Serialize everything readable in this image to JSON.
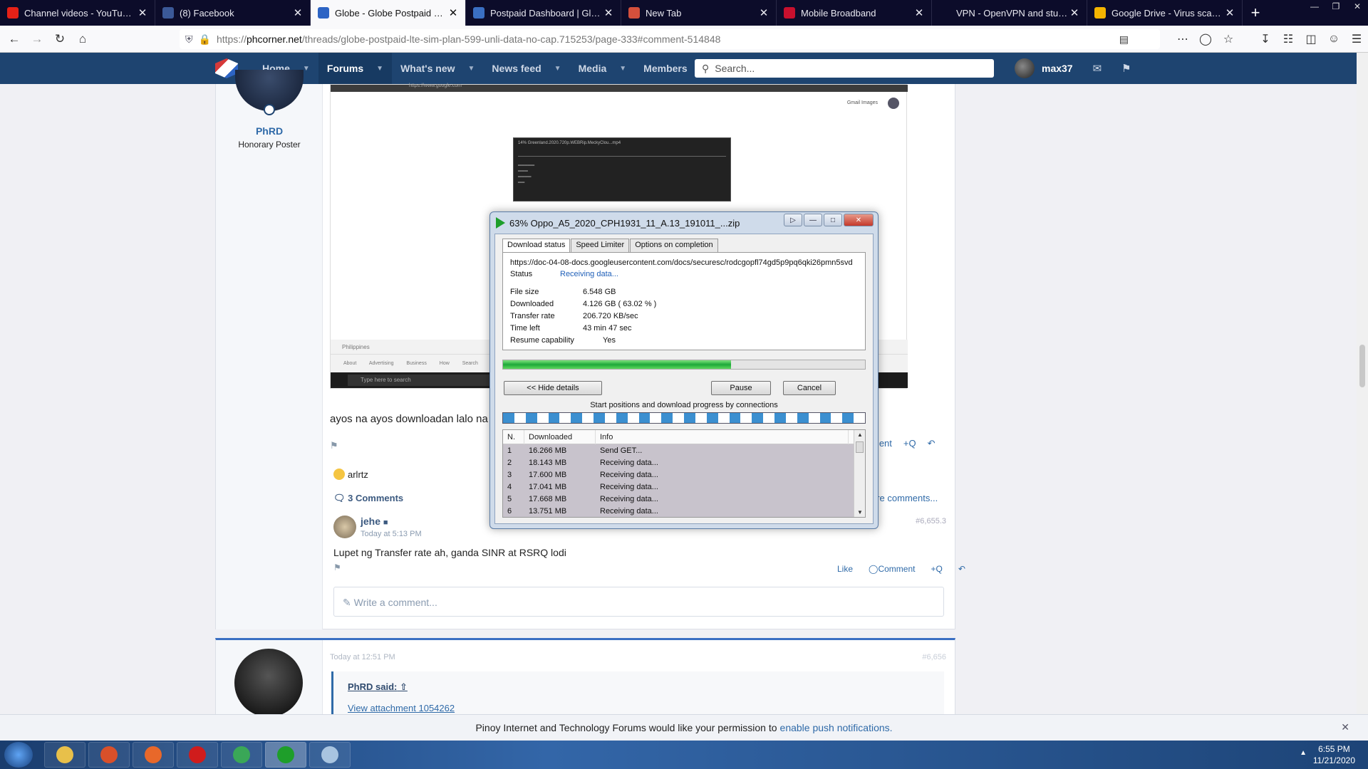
{
  "browser": {
    "tabs": [
      {
        "title": "Channel videos - YouTube Studio",
        "favicon_color": "#e62117",
        "icon": "youtube-icon"
      },
      {
        "title": "(8) Facebook",
        "favicon_color": "#3b5998",
        "icon": "facebook-icon"
      },
      {
        "title": "Globe - Globe Postpaid LTE sim plan",
        "favicon_color": "#2d64c4",
        "icon": "phcorner-icon",
        "active": true
      },
      {
        "title": "Postpaid Dashboard | GlobeOne",
        "favicon_color": "#3a6fc2",
        "icon": "globe-icon"
      },
      {
        "title": "New Tab",
        "favicon_color": "#d4503c",
        "icon": "firefox-icon"
      },
      {
        "title": "Mobile Broadband",
        "favicon_color": "#c8102e",
        "icon": "huawei-icon"
      },
      {
        "title": "VPN - OpenVPN and stunnel",
        "favicon_color": "#0c0c2a",
        "icon": "blank-icon"
      },
      {
        "title": "Google Drive - Virus scan warning",
        "favicon_color": "#f4b400",
        "icon": "google-drive-icon"
      }
    ],
    "url": {
      "prefix": "https://",
      "domain": "phcorner.net",
      "path": "/threads/globe-postpaid-lte-sim-plan-599-unli-data-no-cap.715253/page-333#comment-514848"
    }
  },
  "forum_header": {
    "nav": [
      {
        "label": "Home",
        "active": false
      },
      {
        "label": "Forums",
        "active": true
      },
      {
        "label": "What's new",
        "active": false
      },
      {
        "label": "News feed",
        "active": false
      },
      {
        "label": "Media",
        "active": false
      },
      {
        "label": "Members",
        "active": false
      }
    ],
    "search_placeholder": "Search...",
    "username": "max37"
  },
  "post": {
    "author": "PhRD",
    "author_title": "Honorary Poster",
    "text": "ayos na ayos downloadan lalo na",
    "actions": [
      "ment",
      "+Q"
    ],
    "reaction_user": "arlrtz",
    "comments_label": "3 Comments",
    "more_comments": "ore comments...",
    "screenshot": {
      "address": "https://www.google.com",
      "links": "Gmail   Images",
      "footer_country": "Philippines",
      "footer_links": "About Advertising Business How Search works",
      "taskbar_search": "Type here to search",
      "mini_window_title": "14% Greenland.2020.720p.WEBRip.MeckyClou...mp4"
    }
  },
  "comment": {
    "author": "jehe",
    "time": "Today at 5:13 PM",
    "number": "#6,655.3",
    "text": "Lupet ng Transfer rate ah, ganda SINR at RSRQ lodi",
    "actions": [
      "Like",
      "Comment",
      "+Q"
    ]
  },
  "write_comment_placeholder": "Write a comment...",
  "post2": {
    "time": "Today at 12:51 PM",
    "number": "#6,656",
    "quote_by": "PhRD said:",
    "attachment": "View attachment 1054262"
  },
  "push_notice": {
    "text": "Pinoy Internet and Technology Forums would like your permission to",
    "link": "enable push notifications."
  },
  "idm": {
    "title": "63% Oppo_A5_2020_CPH1931_11_A.13_191011_...zip",
    "tabs": [
      "Download status",
      "Speed Limiter",
      "Options on completion"
    ],
    "url": "https://doc-04-08-docs.googleusercontent.com/docs/securesc/rodcgopfl74gd5p9pq6qki26pmn5svd",
    "status_label": "Status",
    "status_value": "Receiving data...",
    "fields": [
      {
        "k": "File size",
        "v": "6.548  GB"
      },
      {
        "k": "Downloaded",
        "v": "4.126  GB  ( 63.02 % )"
      },
      {
        "k": "Transfer rate",
        "v": "206.720  KB/sec"
      },
      {
        "k": "Time left",
        "v": "43 min 47 sec"
      },
      {
        "k": "Resume capability",
        "v": "Yes"
      }
    ],
    "progress_percent": 63.02,
    "buttons": {
      "hide": "<< Hide details",
      "pause": "Pause",
      "cancel": "Cancel"
    },
    "conn_label": "Start positions and download progress by connections",
    "columns": [
      "N.",
      "Downloaded",
      "Info"
    ],
    "connections": [
      {
        "n": "1",
        "d": "16.266  MB",
        "i": "Send GET..."
      },
      {
        "n": "2",
        "d": "18.143  MB",
        "i": "Receiving data..."
      },
      {
        "n": "3",
        "d": "17.600  MB",
        "i": "Receiving data..."
      },
      {
        "n": "4",
        "d": "17.041  MB",
        "i": "Receiving data..."
      },
      {
        "n": "5",
        "d": "17.668  MB",
        "i": "Receiving data..."
      },
      {
        "n": "6",
        "d": "13.751  MB",
        "i": "Receiving data..."
      }
    ],
    "conn_segment_colors": {
      "done": "#3b8fd0",
      "gap": "#ffffff"
    }
  },
  "taskbar": {
    "time": "6:55 PM",
    "date": "11/21/2020",
    "apps": [
      {
        "name": "explorer",
        "color": "#e8c04a"
      },
      {
        "name": "media-player",
        "color": "#d9502a"
      },
      {
        "name": "firefox",
        "color": "#e8682a"
      },
      {
        "name": "opera",
        "color": "#d01c1c"
      },
      {
        "name": "chrome",
        "color": "#3aa757"
      },
      {
        "name": "idm",
        "color": "#1e9e2a",
        "active": true
      },
      {
        "name": "window",
        "color": "#a8c4e0"
      }
    ]
  }
}
